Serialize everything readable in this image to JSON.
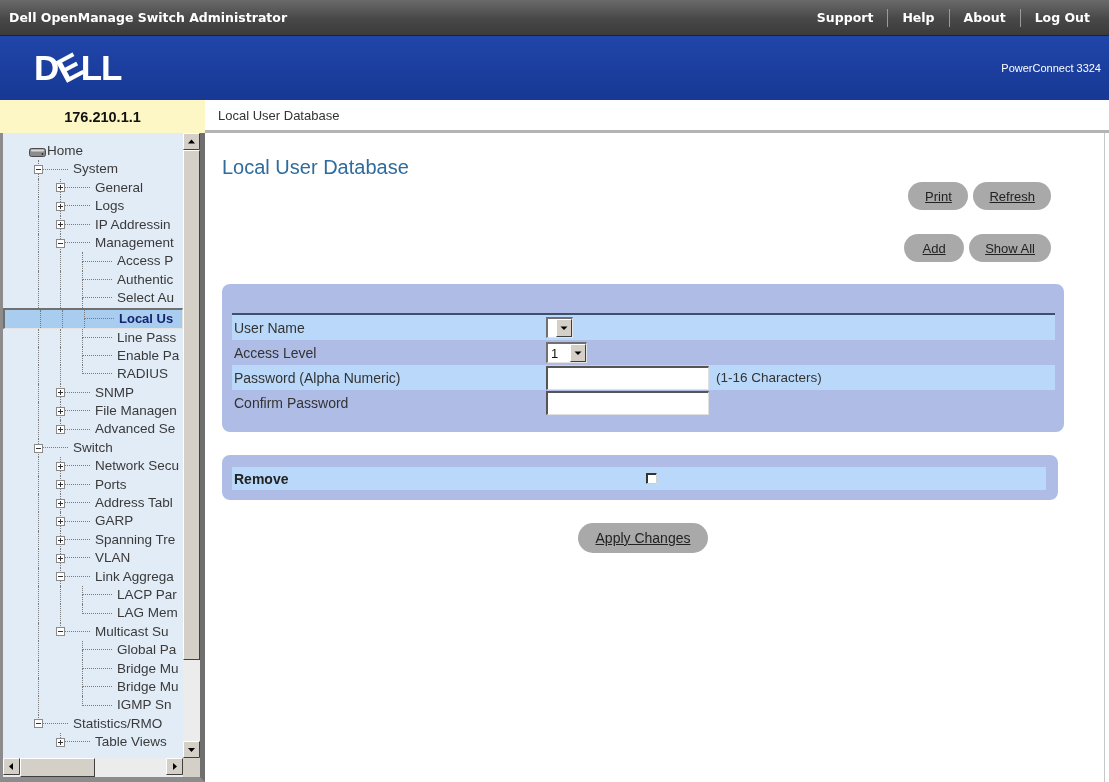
{
  "window": {
    "title": "Dell OpenManage Switch Administrator"
  },
  "top_links": [
    "Support",
    "Help",
    "About",
    "Log Out"
  ],
  "banner": {
    "logo": "DELL",
    "product": "PowerConnect 3324"
  },
  "device_address": "176.210.1.1",
  "breadcrumb": "Local User Database",
  "sidebar": {
    "tree": [
      {
        "label": "Home",
        "selected": false,
        "children": [
          {
            "label": "System",
            "expanded": true,
            "selected": false,
            "children": [
              {
                "label": "General",
                "expanded": false,
                "selected": false
              },
              {
                "label": "Logs",
                "expanded": false,
                "selected": false
              },
              {
                "label": "IP Addressin",
                "expanded": false,
                "selected": false
              },
              {
                "label": "Management",
                "expanded": true,
                "selected": false,
                "children": [
                  {
                    "label": "Access P",
                    "selected": false
                  },
                  {
                    "label": "Authentic",
                    "selected": false
                  },
                  {
                    "label": "Select Au",
                    "selected": false
                  },
                  {
                    "label": "Local Us",
                    "selected": true
                  },
                  {
                    "label": "Line Pass",
                    "selected": false
                  },
                  {
                    "label": "Enable Pa",
                    "selected": false
                  },
                  {
                    "label": "RADIUS",
                    "selected": false
                  }
                ]
              },
              {
                "label": "SNMP",
                "expanded": false,
                "selected": false
              },
              {
                "label": "File Managen",
                "expanded": false,
                "selected": false
              },
              {
                "label": "Advanced Se",
                "expanded": false,
                "selected": false
              }
            ]
          },
          {
            "label": "Switch",
            "expanded": true,
            "selected": false,
            "children": [
              {
                "label": "Network Secu",
                "expanded": false,
                "selected": false
              },
              {
                "label": "Ports",
                "expanded": false,
                "selected": false
              },
              {
                "label": "Address Tabl",
                "expanded": false,
                "selected": false
              },
              {
                "label": "GARP",
                "expanded": false,
                "selected": false
              },
              {
                "label": "Spanning Tre",
                "expanded": false,
                "selected": false
              },
              {
                "label": "VLAN",
                "expanded": false,
                "selected": false
              },
              {
                "label": "Link Aggrega",
                "expanded": true,
                "selected": false,
                "children": [
                  {
                    "label": "LACP Par",
                    "selected": false
                  },
                  {
                    "label": "LAG Mem",
                    "selected": false
                  }
                ]
              },
              {
                "label": "Multicast Su",
                "expanded": true,
                "selected": false,
                "children": [
                  {
                    "label": "Global Pa",
                    "selected": false
                  },
                  {
                    "label": "Bridge Mu",
                    "selected": false
                  },
                  {
                    "label": "Bridge Mu",
                    "selected": false
                  },
                  {
                    "label": "IGMP Sn",
                    "selected": false
                  }
                ]
              }
            ]
          },
          {
            "label": "Statistics/RMO",
            "expanded": true,
            "selected": false,
            "children": [
              {
                "label": "Table Views",
                "expanded": false,
                "selected": false
              }
            ]
          }
        ]
      }
    ]
  },
  "page": {
    "title": "Local User Database",
    "action_rows": [
      [
        "Print",
        "Refresh"
      ],
      [
        "Add",
        "Show All"
      ]
    ],
    "fields": [
      {
        "kind": "select",
        "label": "User Name"
      },
      {
        "kind": "select",
        "label": "Access Level",
        "value": "1"
      },
      {
        "kind": "text",
        "label": "Password (Alpha Numeric)",
        "hint": "(1-16 Characters)"
      },
      {
        "kind": "text",
        "label": "Confirm Password"
      }
    ],
    "remove": {
      "label": "Remove",
      "checked": false
    },
    "apply_button": "Apply Changes"
  }
}
